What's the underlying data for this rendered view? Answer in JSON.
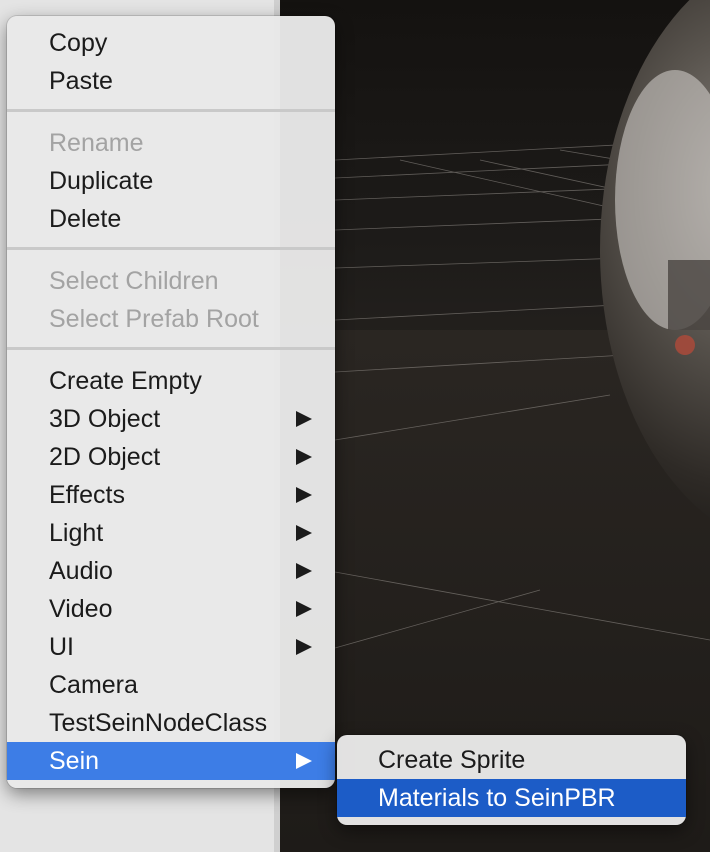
{
  "context_menu": {
    "group1": {
      "copy": "Copy",
      "paste": "Paste"
    },
    "group2": {
      "rename": "Rename",
      "duplicate": "Duplicate",
      "delete": "Delete"
    },
    "group3": {
      "select_children": "Select Children",
      "select_prefab_root": "Select Prefab Root"
    },
    "group4": {
      "create_empty": "Create Empty",
      "object_3d": "3D Object",
      "object_2d": "2D Object",
      "effects": "Effects",
      "light": "Light",
      "audio": "Audio",
      "video": "Video",
      "ui": "UI",
      "camera": "Camera",
      "test_sein_node_class": "TestSeinNodeClass",
      "sein": "Sein"
    },
    "disabled_items": [
      "Rename",
      "Select Children",
      "Select Prefab Root"
    ],
    "highlighted_item": "Sein"
  },
  "submenu": {
    "parent": "Sein",
    "create_sprite": "Create Sprite",
    "materials_to_seinpbr": "Materials to SeinPBR",
    "highlighted_item": "Materials to SeinPBR"
  },
  "colors": {
    "menu_bg": "#e8e8e8",
    "highlight": "#3d7de6",
    "submenu_highlight": "#1c5cc7",
    "disabled_text": "#a3a3a3",
    "scene_bg": "#1c1a18"
  },
  "icons": {
    "submenu_arrow": "triangle-right-icon"
  }
}
